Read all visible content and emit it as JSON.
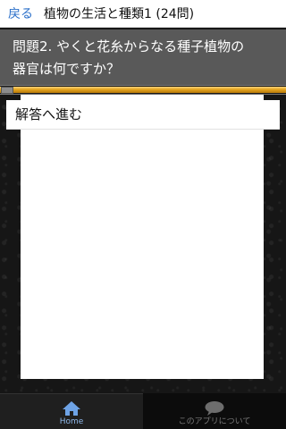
{
  "header": {
    "back_label": "戻る",
    "title": "植物の生活と種類1 (24問)"
  },
  "question": {
    "text_line1": "問題2. やくと花糸からなる種子植物の",
    "text_line2": "器官は何ですか？"
  },
  "progress": {
    "fraction": 1.0
  },
  "answer_button": {
    "label": "解答へ進む"
  },
  "tabbar": {
    "home_label": "Home",
    "about_label": "このアプリについて",
    "home_icon": "home-icon",
    "about_icon": "speech-bubble-icon"
  },
  "colors": {
    "accent": "#2a6fc9",
    "question_bg": "#595959",
    "progress_orange": "#e4a41f",
    "tab_active_text": "#8fb8ea"
  }
}
